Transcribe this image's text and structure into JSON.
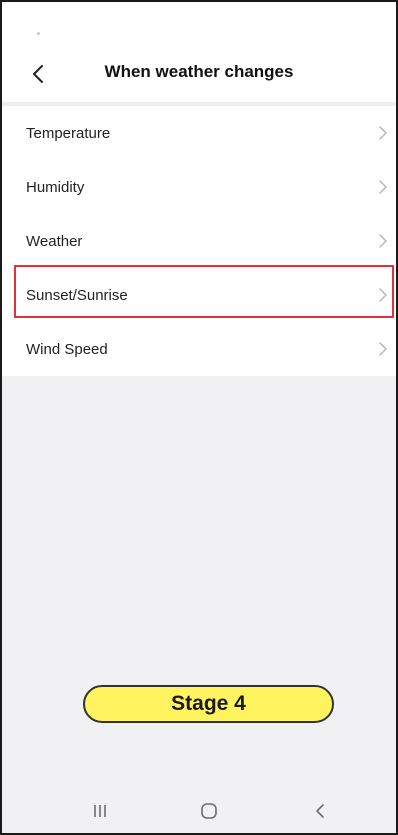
{
  "header": {
    "title": "When weather changes"
  },
  "conditions": [
    {
      "label": "Temperature"
    },
    {
      "label": "Humidity"
    },
    {
      "label": "Weather"
    },
    {
      "label": "Sunset/Sunrise"
    },
    {
      "label": "Wind Speed"
    }
  ],
  "badge": {
    "label": "Stage 4"
  },
  "highlighted_item": "Sunset/Sunrise",
  "colors": {
    "accent_highlight": "#e0303a",
    "badge_fill": "#fff45f",
    "background": "#f1f1f4"
  },
  "icons": {
    "back": "chevron-left-icon",
    "row_arrow": "chevron-right-icon",
    "nav_recents": "recent-apps-icon",
    "nav_home": "home-icon",
    "nav_back": "nav-back-icon"
  }
}
